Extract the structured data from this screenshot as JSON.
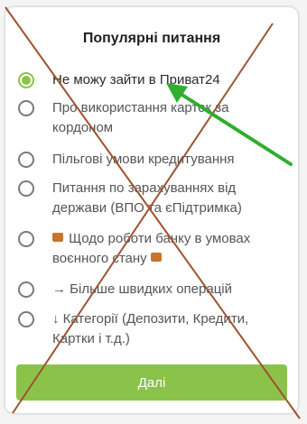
{
  "dialog": {
    "title": "Популярні питання",
    "options": [
      {
        "label": "Не можу зайти в Приват24",
        "selected": true
      },
      {
        "label": "Про використання карток за кордоном",
        "selected": false
      },
      {
        "label": "Пільгові умови кредитування",
        "selected": false
      },
      {
        "label": "Питання по зарахуваннях від держави (ВПО та єПідтримка)",
        "selected": false
      },
      {
        "label_pre": "Щодо роботи банку в умовах воєнного стану",
        "selected": false
      },
      {
        "label": "→ Більше швидких операцій",
        "selected": false
      },
      {
        "label": "↓ Категорії (Депозити, Кредити, Картки і т.д.)",
        "selected": false
      }
    ],
    "next_label": "Далі"
  },
  "colors": {
    "accent": "#8bc34a",
    "annotation_cross": "#a0522d",
    "annotation_arrow": "#2fae2f"
  },
  "icons": [
    "radio-checked-icon",
    "radio-unchecked-icon",
    "emoji-icon"
  ]
}
